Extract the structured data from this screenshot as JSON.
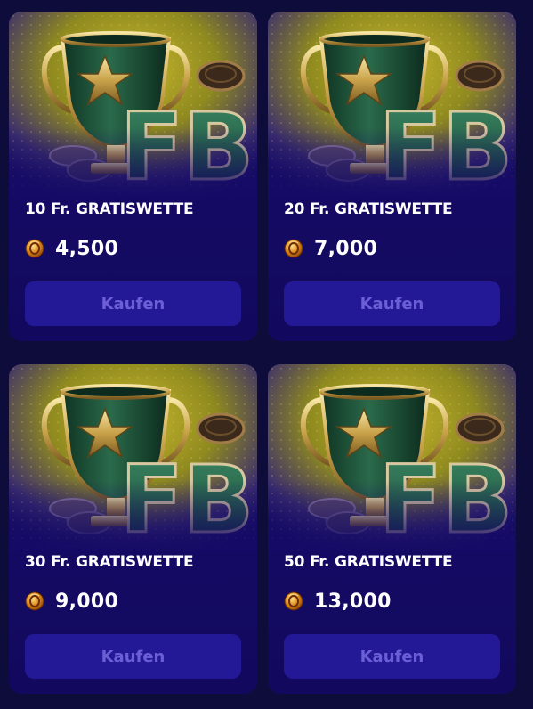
{
  "colors": {
    "page_background": "#0d0c3b",
    "card_background": "#150b66",
    "button_background": "#231896",
    "button_text": "#6c5fd6",
    "title_text": "#ffffff",
    "art_gold": "#b8a62a",
    "trophy_green": "#1e4a35"
  },
  "cards": [
    {
      "title": "10 Fr. GRATISWETTE",
      "price": "4,500",
      "coin_icon": "coin-icon",
      "button_label": "Kaufen",
      "art_text": "FB"
    },
    {
      "title": "20 Fr. GRATISWETTE",
      "price": "7,000",
      "coin_icon": "coin-icon",
      "button_label": "Kaufen",
      "art_text": "FB"
    },
    {
      "title": "30 Fr. GRATISWETTE",
      "price": "9,000",
      "coin_icon": "coin-icon",
      "button_label": "Kaufen",
      "art_text": "FB"
    },
    {
      "title": "50 Fr. GRATISWETTE",
      "price": "13,000",
      "coin_icon": "coin-icon",
      "button_label": "Kaufen",
      "art_text": "FB"
    }
  ]
}
